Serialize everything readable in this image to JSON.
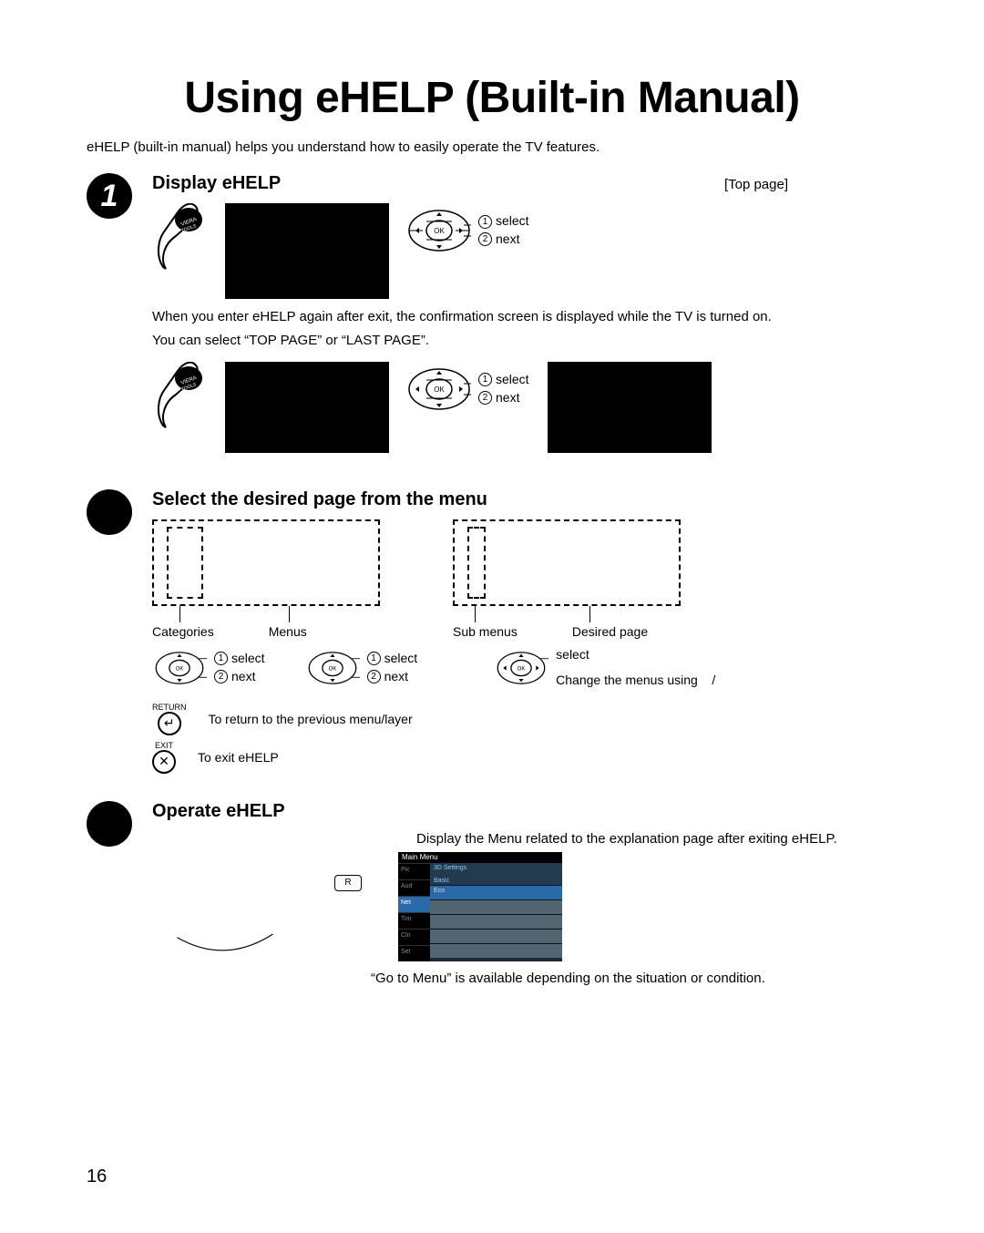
{
  "title": "Using eHELP (Built-in Manual)",
  "intro": "eHELP (built-in manual) helps you understand how to easily operate the TV features.",
  "step1": {
    "num": "1",
    "title": "Display eHELP",
    "top_page": "[Top page]",
    "select": "select",
    "next": "next",
    "note1": "When you enter eHELP again after exit, the confirmation screen is displayed while the TV is turned on.",
    "note2": "You can select “TOP PAGE” or “LAST PAGE”.",
    "viera": "VIERA TOOLS"
  },
  "step2": {
    "title": "Select the desired page from the menu",
    "categories": "Categories",
    "menus": "Menus",
    "submenus": "Sub menus",
    "desired": "Desired page",
    "select": "select",
    "next": "next",
    "change": "Change the menus using",
    "slash": "/",
    "return_btn": "RETURN",
    "return_txt": "To return to the previous menu/layer",
    "exit_btn": "EXIT",
    "exit_txt": "To exit eHELP"
  },
  "step3": {
    "title": "Operate eHELP",
    "lead": "Display the Menu related to the explanation page after exiting eHELP.",
    "r": "R",
    "note": "“Go to Menu” is available depending on the situation or condition.",
    "menu": {
      "hdr": "Main Menu",
      "left": [
        "Pic",
        "Aud",
        "Net",
        "Tim",
        "Cln",
        "Set"
      ],
      "sel_index": 2,
      "right_title": "3D Settings",
      "right_sub": "Basic",
      "items": [
        "Eco",
        "",
        "",
        "",
        ""
      ]
    }
  },
  "page_number": "16"
}
